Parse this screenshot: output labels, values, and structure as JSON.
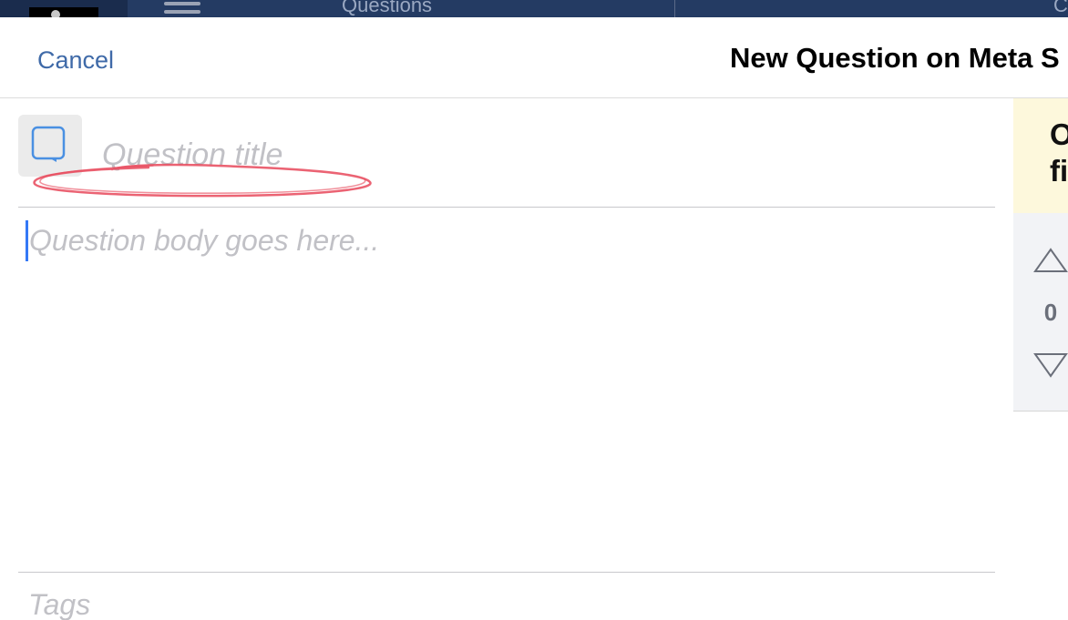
{
  "background_app": {
    "tab_label": "Questions",
    "right_fragment": "C"
  },
  "navbar": {
    "cancel_label": "Cancel",
    "title": "New Question on Meta S"
  },
  "form": {
    "title_placeholder": "Question title",
    "body_placeholder": "Question body goes here...",
    "tags_placeholder": "Tags"
  },
  "preview": {
    "notice_text": "O\nfi",
    "vote_count": "0"
  },
  "colors": {
    "accent": "#3f6aa8",
    "caret": "#3478f6",
    "annotation": "#e8485a",
    "notice_bg": "#fdf8dc"
  }
}
